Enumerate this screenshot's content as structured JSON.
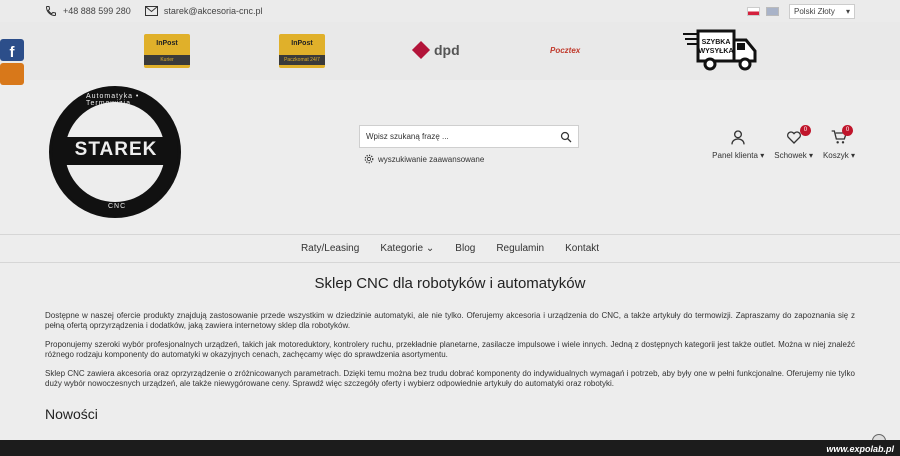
{
  "topbar": {
    "phone": "+48 888 599 280",
    "email": "starek@akcesoria-cnc.pl",
    "currency": "Polski Złoty"
  },
  "carriers": {
    "inpost_kurier_brand": "InPost",
    "inpost_kurier_sub": "Kurier",
    "inpost_paczkomat_brand": "InPost",
    "inpost_paczkomat_sub": "Paczkomat 24/7",
    "dpd": "dpd",
    "pocztex": "Pocztex",
    "fast_shipping_line1": "SZYBKA",
    "fast_shipping_line2": "WYSYŁKA"
  },
  "logo": {
    "name": "STAREK",
    "ring_top": "Automatyka • Termowizja",
    "ring_bottom": "CNC"
  },
  "search": {
    "placeholder": "Wpisz szukaną frazę ...",
    "advanced": "wyszukiwanie zaawansowane"
  },
  "actions": {
    "account": "Panel klienta",
    "wishlist": "Schowek",
    "wishlist_count": "0",
    "cart": "Koszyk",
    "cart_count": "0"
  },
  "nav": {
    "items": [
      "Raty/Leasing",
      "Kategorie",
      "Blog",
      "Regulamin",
      "Kontakt"
    ]
  },
  "main": {
    "title": "Sklep CNC dla robotyków i automatyków",
    "paragraphs": [
      "Dostępne w naszej ofercie produkty znajdują zastosowanie przede wszystkim w dziedzinie automatyki, ale nie tylko. Oferujemy akcesoria i urządzenia do CNC, a także artykuły do termowizji. Zapraszamy do zapoznania się z pełną ofertą oprzyrządzenia i dodatków, jaką zawiera internetowy sklep dla robotyków.",
      "Proponujemy szeroki wybór profesjonalnych urządzeń, takich jak motoreduktory, kontrolery ruchu, przekładnie planetarne, zasilacze impulsowe i wiele innych. Jedną z dostępnych kategorii jest także outlet. Można w niej znaleźć różnego rodzaju komponenty do automatyki w okazyjnych cenach, zachęcamy więc do sprawdzenia asortymentu.",
      "Sklep CNC zawiera akcesoria oraz oprzyrządzenie o zróżnicowanych parametrach. Dzięki temu można bez trudu dobrać komponenty do indywidualnych wymagań i potrzeb, aby były one w pełni funkcjonalne. Oferujemy nie tylko duży wybór nowoczesnych urządzeń, ale także niewygórowane ceny. Sprawdź więc szczegóły oferty i wybierz odpowiednie artykuły do automatyki oraz robotyki."
    ],
    "new_section": "Nowości"
  },
  "watermark": "www.expolab.pl"
}
